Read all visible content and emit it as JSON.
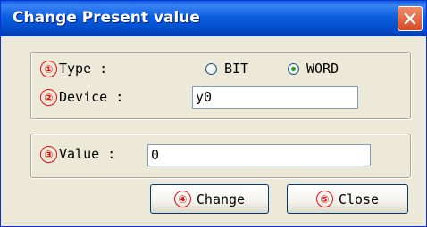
{
  "dialog": {
    "title": "Change Present value",
    "close_icon": "close-x-icon"
  },
  "type_row": {
    "number": "①",
    "label": "Type :",
    "options": [
      {
        "label": "BIT",
        "checked": false
      },
      {
        "label": "WORD",
        "checked": true
      }
    ]
  },
  "device_row": {
    "number": "②",
    "label": "Device :",
    "value": "y0"
  },
  "value_row": {
    "number": "③",
    "label": "Value :",
    "value": "0"
  },
  "buttons": {
    "change": {
      "number": "④",
      "label": "Change"
    },
    "close": {
      "number": "⑤",
      "label": "Close"
    }
  },
  "colors": {
    "titlebar": "#0b5fe0",
    "annotation": "#e01010",
    "close_button": "#d84a22"
  }
}
